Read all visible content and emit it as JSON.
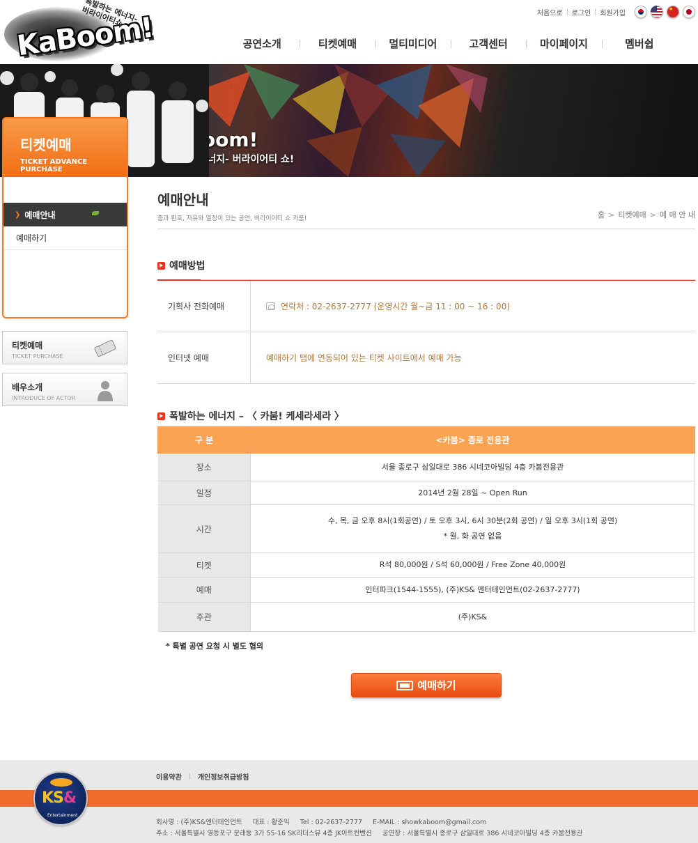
{
  "header": {
    "logo_text": "KaBoom!",
    "logo_tagline": "폭발하는 에너지- 버라이어티쇼",
    "top_links": [
      "처음으로",
      "로그인",
      "회원가입"
    ],
    "languages": [
      "korean-flag-icon",
      "us-flag-icon",
      "china-flag-icon",
      "japan-flag-icon"
    ],
    "gnb": [
      "공연소개",
      "티켓예매",
      "멀티미디어",
      "고객센터",
      "마이페이지",
      "멤버쉽"
    ]
  },
  "visual": {
    "title": "KaBoom!",
    "subtitle": "폭발하는 에너지- 버라이어티 쇼!"
  },
  "sidebar": {
    "title": "티켓예매",
    "subtitle": "TICKET ADVANCE PURCHASE",
    "menu": [
      {
        "label": "예매안내",
        "active": true
      },
      {
        "label": "예매하기",
        "active": false
      }
    ],
    "quick": [
      {
        "title": "티켓예매",
        "sub": "TICKET PURCHASE",
        "icon": "ticket-icon"
      },
      {
        "title": "배우소개",
        "sub": "INTRODUCE OF ACTOR",
        "icon": "person-icon"
      }
    ]
  },
  "page": {
    "title": "예매안내",
    "description": "춤과 환호, 자유와 열정이 있는 공연, 버라이어티 쇼 카붐!",
    "breadcrumb": [
      "홈",
      "티켓예매",
      "예 매 안 내"
    ]
  },
  "method": {
    "heading": "예매방법",
    "rows": [
      {
        "label": "기획사 전화예매",
        "value": "연락처 : 02-2637-2777 (운영시간 월~금 11 : 00 ~ 16 : 00)"
      },
      {
        "label": "인터넷 예매",
        "value": "예매하기 탭에 연동되어 있는 티켓 사이트에서 예매 가능"
      }
    ]
  },
  "info": {
    "heading": "폭발하는 에너지 – 〈 카붐! 케세라세라 〉",
    "col1": "구 분",
    "col2": "<카붐> 종로 전용관",
    "rows": [
      {
        "label": "장소",
        "value": "서울 종로구 삼일대로 386 시네코아빌딩 4층 카붐전용관"
      },
      {
        "label": "일정",
        "value": "2014년 2월 28일 ~ Open Run"
      },
      {
        "label": "시간",
        "value": "수, 목, 금 오후 8시(1회공연) / 토 오후 3시, 6시 30분(2회 공연) / 일 오후 3시(1회 공연)",
        "value2": "* 월, 화 공연 없음"
      },
      {
        "label": "티켓",
        "value": "R석 80,000원 / S석 60,000원 / Free Zone 40,000원"
      },
      {
        "label": "예매",
        "value": "인터파크(1544-1555), (주)KS& 엔터테인먼트(02-2637-2777)"
      },
      {
        "label": "주관",
        "value": "(주)KS&"
      }
    ],
    "note": "* 특별 공연 요청 시 별도 협의"
  },
  "book_button": "예매하기",
  "footer": {
    "links": [
      "이용약관",
      "개인정보취급방침"
    ],
    "logo_text_a": "KS",
    "logo_text_b": "&",
    "logo_en": "Entertainment",
    "line1": [
      "회사명 : (주)KS&엔터테인먼트",
      "대표 : 황준익",
      "Tel : 02-2637-2777",
      "E-MAIL : showkaboom@gmail.com"
    ],
    "line2": [
      "주소 : 서울특별시 영등포구 문래동 3가 55-16 SK리더스뷰 4층 JK아트컨벤션",
      "공연장 : 서울특별시 종로구 삼일대로 386 시네코아빌딩 4층 카붐전용관"
    ]
  },
  "colors": {
    "accent": "#f47b20",
    "accent_dark": "#e2351b",
    "table_head": "#f9a353",
    "text_link": "#b0793a"
  }
}
